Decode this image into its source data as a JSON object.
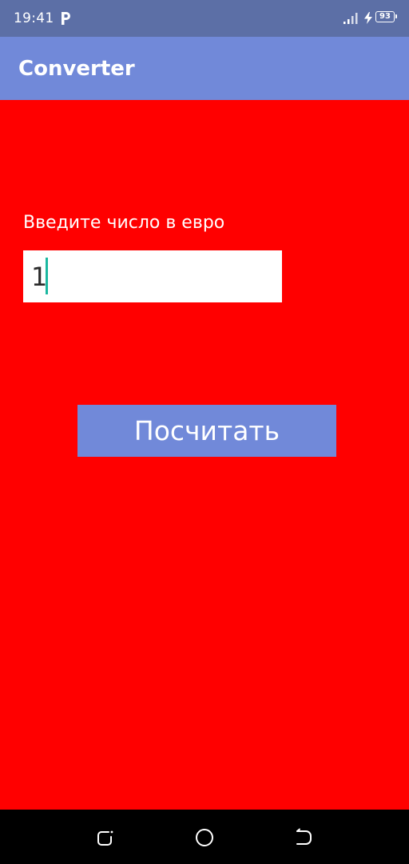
{
  "status_bar": {
    "time": "19:41",
    "app_icon": "p-icon",
    "signal_icon": "signal-icon",
    "charging_icon": "charging-bolt-icon",
    "battery_level": "93"
  },
  "app_bar": {
    "title": "Converter",
    "color": "#7189d9"
  },
  "main": {
    "background_color": "#ff0000",
    "prompt_label": "Введите число в евро",
    "euro_input": {
      "value": "1",
      "cursor_color": "#1ab8a0"
    },
    "calculate_button": "Посчитать"
  },
  "nav_bar": {
    "recent_icon": "recent-apps-icon",
    "home_icon": "home-icon",
    "back_icon": "back-icon"
  }
}
